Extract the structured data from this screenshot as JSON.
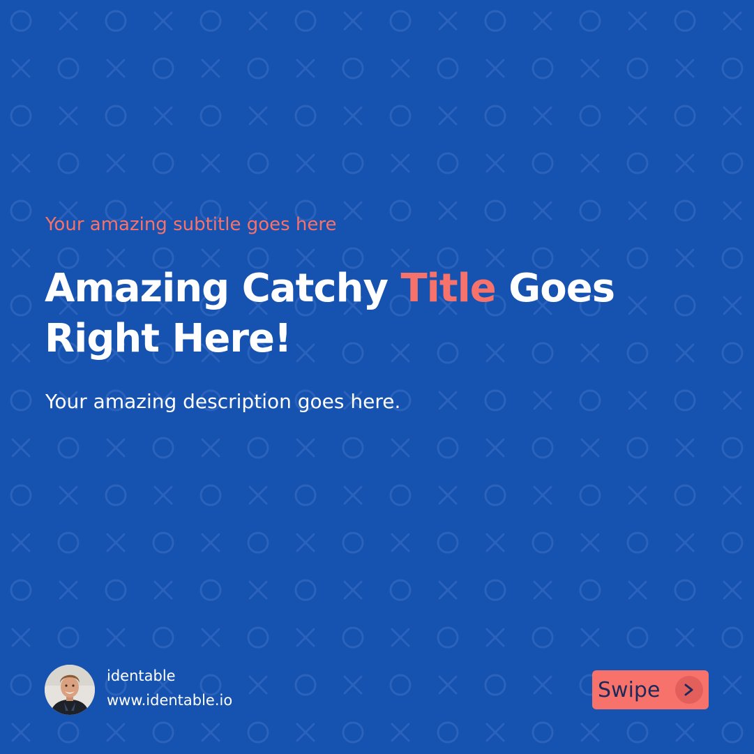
{
  "slide": {
    "subtitle": "Your amazing subtitle goes here",
    "title_part1": "Amazing Catchy ",
    "title_accent": "Title",
    "title_part2": " Goes Right Here!",
    "description": "Your amazing description goes here."
  },
  "brand": {
    "name": "identable",
    "url": "www.identable.io"
  },
  "cta": {
    "label": "Swipe",
    "icon": "chevron-right-icon"
  },
  "colors": {
    "background": "#1652b0",
    "accent": "#f7726a",
    "text": "#ffffff",
    "button_text": "#1b2a5a"
  }
}
